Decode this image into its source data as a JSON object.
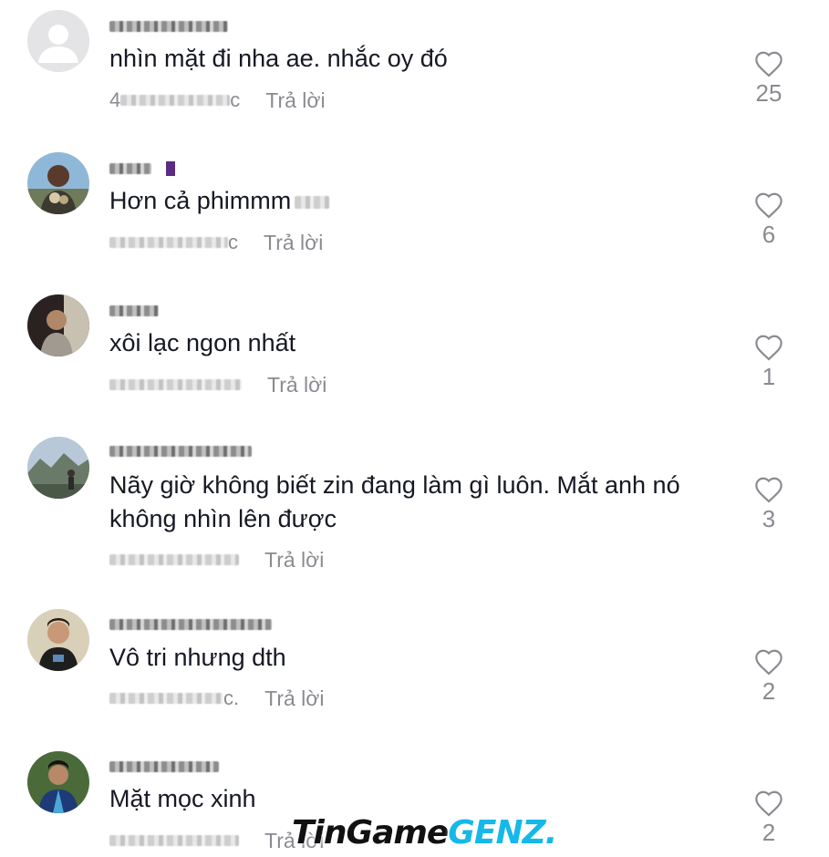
{
  "comments": [
    {
      "text": "nhìn mặt đi nha ae. nhắc oy đó",
      "date_fragment": "4",
      "date_tail": "c",
      "reply_label": "Trả lời",
      "like_count": "25",
      "icon": "heart-outline-icon"
    },
    {
      "text": "Hơn cả phimmm",
      "date_fragment": "",
      "date_tail": "c",
      "reply_label": "Trả lời",
      "like_count": "6",
      "icon": "heart-outline-icon"
    },
    {
      "text": "xôi lạc ngon nhất",
      "date_fragment": "",
      "date_tail": "",
      "reply_label": "Trả lời",
      "like_count": "1",
      "icon": "heart-outline-icon"
    },
    {
      "text": "Nãy giờ không biết zin đang làm gì luôn. Mắt anh nó không nhìn lên được",
      "date_fragment": "",
      "date_tail": "",
      "reply_label": "Trả lời",
      "like_count": "3",
      "icon": "heart-outline-icon"
    },
    {
      "text": "Vô tri nhưng dth",
      "date_fragment": "",
      "date_tail": "c.",
      "reply_label": "Trả lời",
      "like_count": "2",
      "icon": "heart-outline-icon"
    },
    {
      "text": "Mặt mọc xinh",
      "date_fragment": "",
      "date_tail": "",
      "reply_label": "Trả lời",
      "like_count": "2",
      "icon": "heart-outline-icon"
    }
  ],
  "watermark": {
    "part1": "TinGame",
    "part2": "GENZ."
  },
  "colors": {
    "text": "#161823",
    "muted": "#8a8b91",
    "watermark_accent": "#16b8e8"
  }
}
